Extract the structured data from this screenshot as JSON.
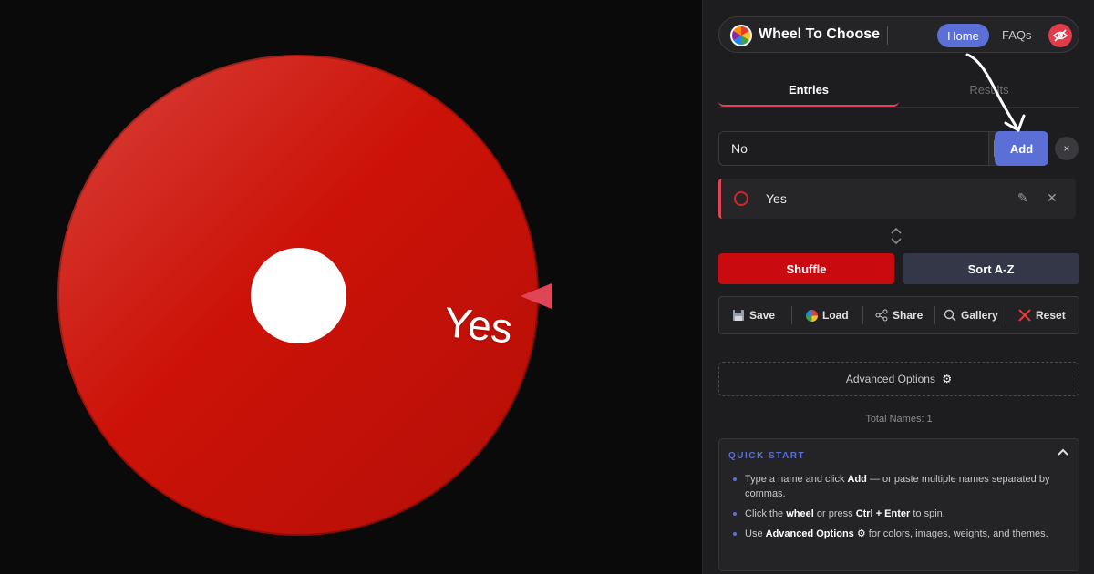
{
  "wheel": {
    "slice_label": "Yes",
    "slice_color": "#cc1208"
  },
  "nav": {
    "brand": "Wheel To Choose",
    "home": "Home",
    "faqs": "FAQs"
  },
  "tabs": {
    "entries": "Entries",
    "results": "Results"
  },
  "entry_form": {
    "input_value": "No",
    "add_label": "Add",
    "clear_label": "×"
  },
  "entries": [
    {
      "label": "Yes",
      "color": "#d0262a"
    }
  ],
  "actions": {
    "shuffle": "Shuffle",
    "sort": "Sort A-Z"
  },
  "toolbar": {
    "save": "Save",
    "load": "Load",
    "share": "Share",
    "gallery": "Gallery",
    "reset": "Reset"
  },
  "advanced": {
    "label": "Advanced Options"
  },
  "total_names": "Total Names: 1",
  "quick_start": {
    "title": "QUICK START",
    "item1_a": "Type a name and click ",
    "item1_b": "Add",
    "item1_c": " — or paste multiple names separated by commas.",
    "item2_a": "Click the ",
    "item2_b": "wheel",
    "item2_c": " or press ",
    "item2_d": "Ctrl + Enter",
    "item2_e": " to spin.",
    "item3_a": "Use ",
    "item3_b": "Advanced Options",
    "item3_c": " for colors, images, weights, and themes."
  },
  "colors": {
    "accent": "#5b6fd6",
    "danger": "#c90a0f",
    "pointer": "#e04556"
  }
}
